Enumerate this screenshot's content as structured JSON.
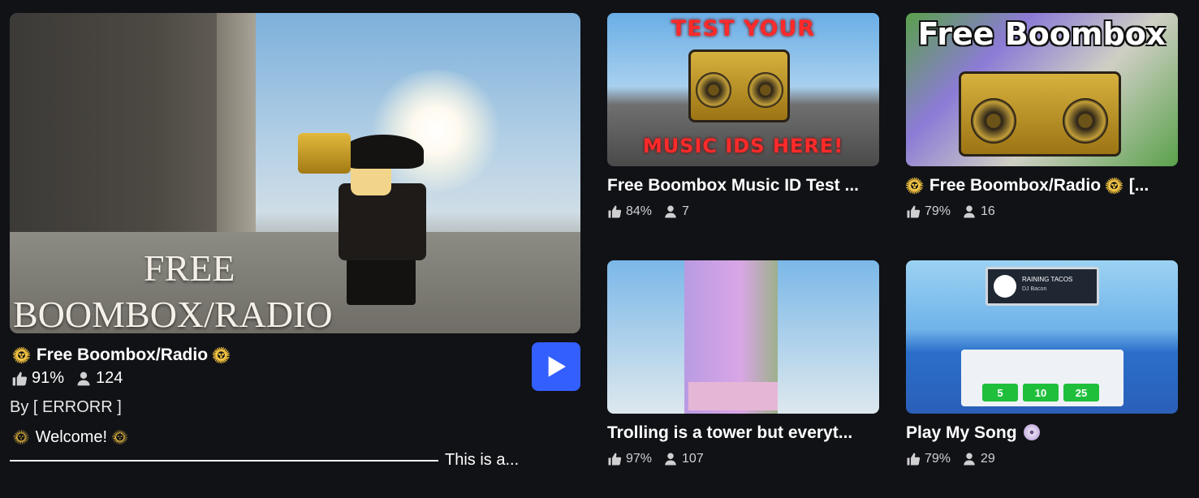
{
  "featured": {
    "thumb_line1": "FREE",
    "thumb_line2": "BOOMBOX/RADIO",
    "title": "Free Boombox/Radio",
    "like_percent": "91%",
    "player_count": "124",
    "creator": "By [ ERRORR ]",
    "description_line1": "Welcome!",
    "description_line2": "This is a..."
  },
  "cards": [
    {
      "thumb_top": "TEST YOUR",
      "thumb_bottom": "MUSIC IDS HERE!",
      "title": "Free Boombox Music ID Test ...",
      "like_percent": "84%",
      "player_count": "7"
    },
    {
      "thumb_top": "Free Boombox",
      "title": "Free Boombox/Radio",
      "title_suffix": "[...",
      "like_percent": "79%",
      "player_count": "16"
    },
    {
      "title": "Trolling is a tower but everyt...",
      "like_percent": "97%",
      "player_count": "107"
    },
    {
      "screen_title": "RAINING TACOS",
      "screen_sub": "DJ Bacon",
      "tips": [
        "5",
        "10",
        "25"
      ],
      "title": "Play My Song",
      "like_percent": "79%",
      "player_count": "29"
    }
  ],
  "colors": {
    "background": "#111216",
    "play_button": "#335fff",
    "stat_text": "#d0d0d3"
  },
  "icons": {
    "like": "thumbs-up-icon",
    "players": "person-icon",
    "play": "play-icon",
    "sun": "sun-emoji",
    "disc": "disc-emoji"
  }
}
